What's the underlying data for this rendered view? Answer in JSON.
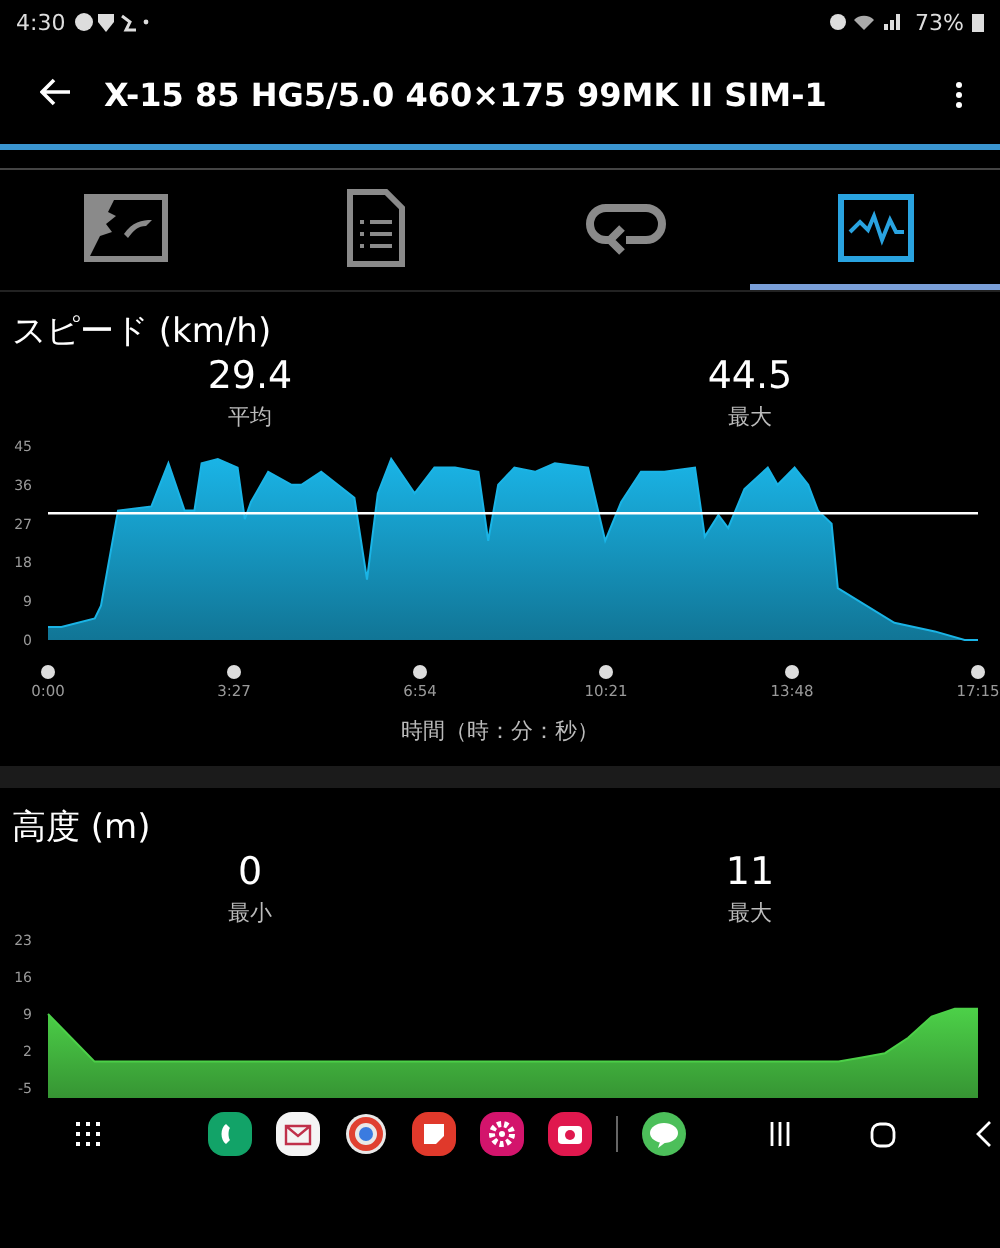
{
  "status_bar": {
    "time": "4:30",
    "battery": "73%"
  },
  "app_bar": {
    "title": "X-15 85 HG5/5.0 460×175 99MK II SIM-1"
  },
  "tabs": [
    {
      "selected": false
    },
    {
      "selected": false
    },
    {
      "selected": false
    },
    {
      "selected": true
    }
  ],
  "speed": {
    "title": "スピード (km/h)",
    "stats": [
      {
        "value": "29.4",
        "label": "平均"
      },
      {
        "value": "44.5",
        "label": "最大"
      }
    ],
    "chart_data": {
      "type": "area",
      "xlabel": "時間（時：分：秒）",
      "x": [
        0,
        15,
        52,
        59,
        78,
        115,
        134,
        152,
        163,
        171,
        189,
        211,
        219,
        226,
        245,
        271,
        282,
        304,
        341,
        355,
        367,
        382,
        408,
        430,
        453,
        479,
        490,
        501,
        519,
        542,
        564,
        601,
        620,
        638,
        660,
        686,
        720,
        731,
        746,
        757,
        775,
        801,
        812,
        831,
        846,
        857,
        872,
        879,
        942,
        987,
        1020,
        1035
      ],
      "series": [
        {
          "color": "#1ab4e6",
          "values": [
            3,
            3,
            5,
            8,
            30,
            31,
            41,
            30,
            30,
            41,
            42,
            40,
            28,
            32,
            39,
            36,
            36,
            39,
            33,
            14,
            34,
            42,
            34,
            40,
            40,
            39,
            23,
            36,
            40,
            39,
            41,
            40,
            23,
            32,
            39,
            39,
            40,
            24,
            29,
            26,
            35,
            40,
            36,
            40,
            36,
            30,
            27,
            12,
            4,
            2,
            0,
            0
          ]
        },
        {
          "type": "line",
          "color": "#ffffff",
          "values": [
            29.4,
            29.4,
            29.4,
            29.4,
            29.4,
            29.4,
            29.4,
            29.4,
            29.4,
            29.4,
            29.4,
            29.4,
            29.4,
            29.4,
            29.4,
            29.4,
            29.4,
            29.4,
            29.4,
            29.4,
            29.4,
            29.4,
            29.4,
            29.4,
            29.4,
            29.4,
            29.4,
            29.4,
            29.4,
            29.4,
            29.4,
            29.4,
            29.4,
            29.4,
            29.4,
            29.4,
            29.4,
            29.4,
            29.4,
            29.4,
            29.4,
            29.4,
            29.4,
            29.4,
            29.4,
            29.4,
            29.4,
            29.4,
            29.4,
            29.4,
            29.4,
            29.4
          ]
        }
      ],
      "xlim": [
        0,
        1035
      ],
      "ylim": [
        0,
        45
      ],
      "yticks": [
        0,
        9,
        18,
        27,
        36,
        45
      ],
      "xticks": [
        {
          "value": 0,
          "label": "0:00"
        },
        {
          "value": 207,
          "label": "3:27"
        },
        {
          "value": 414,
          "label": "6:54"
        },
        {
          "value": 621,
          "label": "10:21"
        },
        {
          "value": 828,
          "label": "13:48"
        },
        {
          "value": 1035,
          "label": "17:15"
        }
      ]
    }
  },
  "altitude": {
    "title": "高度 (m)",
    "stats": [
      {
        "value": "0",
        "label": "最小"
      },
      {
        "value": "11",
        "label": "最大"
      }
    ],
    "chart_data": {
      "type": "area",
      "categories": [
        null,
        null,
        null,
        null,
        null,
        null,
        null,
        null,
        null,
        null,
        null,
        null,
        null,
        null,
        null,
        null,
        null,
        null,
        null,
        null,
        null,
        null,
        null,
        null,
        null,
        null,
        null,
        null,
        null,
        null,
        null,
        null,
        null,
        null,
        null,
        null,
        null,
        null,
        null,
        null,
        null
      ],
      "series": [
        {
          "color": "#4cd048",
          "values": [
            9,
            4.5,
            0,
            0,
            0,
            0,
            0,
            0,
            0,
            0,
            0,
            0,
            0,
            0,
            0,
            0,
            0,
            0,
            0,
            0,
            0,
            0,
            0,
            0,
            0,
            0,
            0,
            0,
            0,
            0,
            0,
            0,
            0,
            0,
            0,
            0.8,
            1.6,
            4.5,
            8.5,
            10,
            10
          ]
        }
      ],
      "ylim": [
        -5,
        23
      ],
      "yticks": [
        -5,
        2,
        9,
        16,
        23
      ]
    }
  },
  "dock": [
    {
      "kind": "phone",
      "color": "#12a368"
    },
    {
      "kind": "mail",
      "color": "#f4f4f4"
    },
    {
      "kind": "ring",
      "color": "#e8e8e8"
    },
    {
      "kind": "note",
      "color": "#e0392b"
    },
    {
      "kind": "flower",
      "color": "#d3146c"
    },
    {
      "kind": "camera",
      "color": "#e0184e"
    },
    {
      "kind": "chat",
      "color": "#4cbf5a"
    }
  ]
}
